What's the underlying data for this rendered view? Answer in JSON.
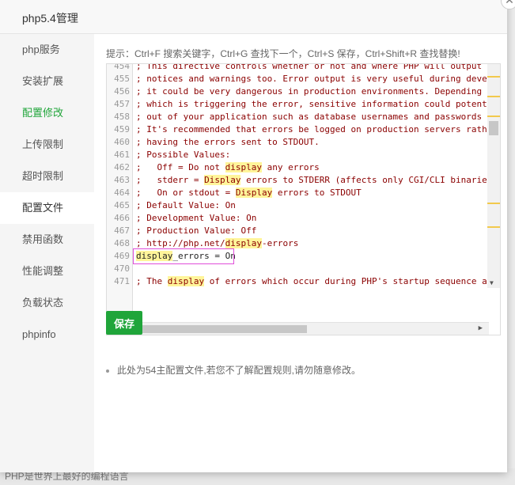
{
  "modal": {
    "title": "php5.4管理",
    "close_label": "✕"
  },
  "sidebar": {
    "items": [
      {
        "label": "php服务"
      },
      {
        "label": "安装扩展"
      },
      {
        "label": "配置修改"
      },
      {
        "label": "上传限制"
      },
      {
        "label": "超时限制"
      },
      {
        "label": "配置文件"
      },
      {
        "label": "禁用函数"
      },
      {
        "label": "性能调整"
      },
      {
        "label": "负载状态"
      },
      {
        "label": "phpinfo"
      }
    ],
    "active_index": 5
  },
  "editor": {
    "hint": "提示：Ctrl+F 搜索关键字，Ctrl+G 查找下一个，Ctrl+S 保存，Ctrl+Shift+R 查找替换!",
    "lines": [
      {
        "no": "454",
        "parts": [
          "; This directive controls whether or not and where PHP will output errors,"
        ]
      },
      {
        "no": "455",
        "parts": [
          "; notices and warnings too. Error output is very useful during development"
        ]
      },
      {
        "no": "456",
        "parts": [
          "; it could be very dangerous in production environments. Depending on the"
        ]
      },
      {
        "no": "457",
        "parts": [
          "; which is triggering the error, sensitive information could potentially l"
        ]
      },
      {
        "no": "458",
        "parts": [
          "; out of your application such as database usernames and passwords or wors"
        ]
      },
      {
        "no": "459",
        "parts": [
          "; It's recommended that errors be logged on production servers rather than"
        ]
      },
      {
        "no": "460",
        "parts": [
          "; having the errors sent to STDOUT."
        ]
      },
      {
        "no": "461",
        "parts": [
          "; Possible Values:"
        ]
      },
      {
        "no": "462",
        "parts": [
          ";   Off = Do not ",
          "display",
          " any errors"
        ]
      },
      {
        "no": "463",
        "parts": [
          ";   stderr = ",
          "Display",
          " errors to STDERR (affects only CGI/CLI binaries!)"
        ]
      },
      {
        "no": "464",
        "parts": [
          ";   On or stdout = ",
          "Display",
          " errors to STDOUT"
        ]
      },
      {
        "no": "465",
        "parts": [
          "; Default Value: On"
        ]
      },
      {
        "no": "466",
        "parts": [
          "; Development Value: On"
        ]
      },
      {
        "no": "467",
        "parts": [
          "; Production Value: Off"
        ]
      },
      {
        "no": "468",
        "parts": [
          "; http://php.net/",
          "display",
          "-errors"
        ]
      },
      {
        "no": "469",
        "parts": [
          "display",
          "_errors = On"
        ],
        "plain": true
      },
      {
        "no": "470",
        "parts": [
          ""
        ]
      },
      {
        "no": "471",
        "parts": [
          "; The ",
          "display",
          " of errors which occur during PHP's startup sequence are hand"
        ]
      }
    ]
  },
  "save_label": "保存",
  "note": "此处为54主配置文件,若您不了解配置规则,请勿随意修改。",
  "background_text": "PHP是世界上最好的编程语言",
  "colors": {
    "accent": "#20a53a",
    "comment": "#8b0000",
    "highlight": "#fff59a",
    "selection_border": "#e04ed9"
  }
}
